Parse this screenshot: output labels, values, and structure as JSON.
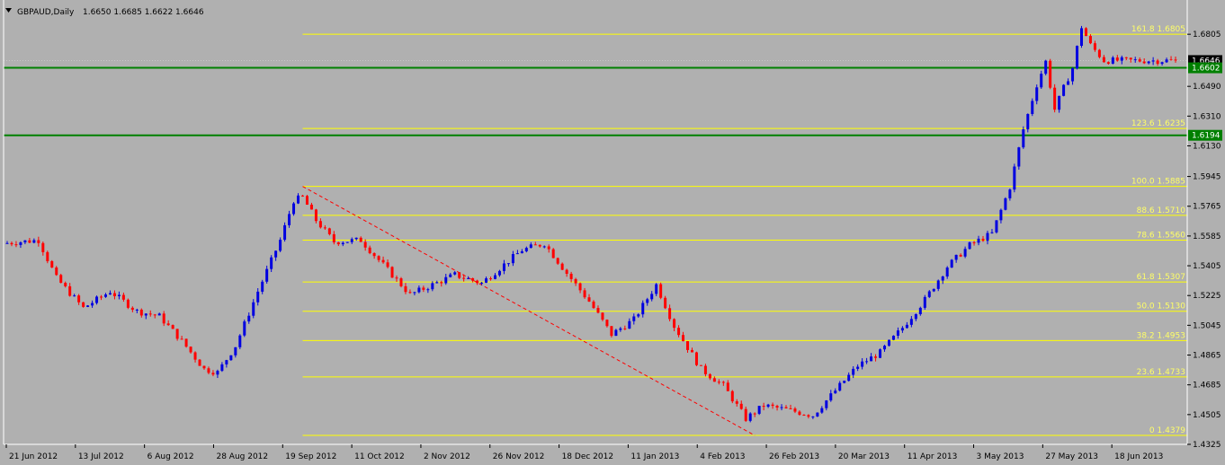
{
  "header": {
    "symbol": "GBPAUD,Daily",
    "ohlc": "1.6650 1.6685 1.6622 1.6646",
    "menu_icon": "triangle-down-icon"
  },
  "colors": {
    "background": "#b0b0b0",
    "axis": "#ffffff",
    "bull": "#0000e0",
    "bear": "#ff0000",
    "fib": "#ffff00",
    "fib_text": "#ffff66",
    "support": "#008000",
    "trend": "#ff0000",
    "text": "#000000"
  },
  "chart_data": {
    "type": "candlestick",
    "title": "GBPAUD,Daily",
    "y_range": [
      1.4325,
      1.6985
    ],
    "y_ticks": [
      "1.6805",
      "1.6490",
      "1.6310",
      "1.6130",
      "1.5945",
      "1.5765",
      "1.5585",
      "1.5405",
      "1.5225",
      "1.5045",
      "1.4865",
      "1.4685",
      "1.4505",
      "1.4325"
    ],
    "x_labels": [
      "21 Jun 2012",
      "13 Jul 2012",
      "6 Aug 2012",
      "28 Aug 2012",
      "19 Sep 2012",
      "11 Oct 2012",
      "2 Nov 2012",
      "26 Nov 2012",
      "18 Dec 2012",
      "11 Jan 2013",
      "4 Feb 2013",
      "26 Feb 2013",
      "20 Mar 2013",
      "11 Apr 2013",
      "3 May 2013",
      "27 May 2013",
      "18 Jun 2013"
    ],
    "bar_count": 262,
    "fib_levels": [
      {
        "label": "161.8 1.6805",
        "value": 1.6805
      },
      {
        "label": "123.6 1.6235",
        "value": 1.6235
      },
      {
        "label": "100.0 1.5885",
        "value": 1.5885
      },
      {
        "label": "88.6 1.5710",
        "value": 1.571
      },
      {
        "label": "78.6 1.5560",
        "value": 1.556
      },
      {
        "label": "61.8 1.5307",
        "value": 1.5307
      },
      {
        "label": "50.0 1.5130",
        "value": 1.513
      },
      {
        "label": "38.2 1.4953",
        "value": 1.4953
      },
      {
        "label": "23.6 1.4733",
        "value": 1.4733
      },
      {
        "label": "0 1.4379",
        "value": 1.4379
      }
    ],
    "support_lines": [
      {
        "label": "1.6602",
        "value": 1.6602
      },
      {
        "label": "1.6194",
        "value": 1.6194
      }
    ],
    "current_price": {
      "label": "1.6646",
      "value": 1.6646
    },
    "trendline": {
      "from": [
        66,
        1.5885
      ],
      "to": [
        167,
        1.4379
      ]
    },
    "anchors": [
      [
        0,
        1.554
      ],
      [
        8,
        1.556
      ],
      [
        12,
        1.533
      ],
      [
        18,
        1.515
      ],
      [
        24,
        1.525
      ],
      [
        30,
        1.513
      ],
      [
        35,
        1.51
      ],
      [
        40,
        1.495
      ],
      [
        45,
        1.478
      ],
      [
        48,
        1.476
      ],
      [
        52,
        1.492
      ],
      [
        57,
        1.525
      ],
      [
        62,
        1.556
      ],
      [
        65,
        1.58
      ],
      [
        67,
        1.582
      ],
      [
        70,
        1.568
      ],
      [
        74,
        1.555
      ],
      [
        80,
        1.556
      ],
      [
        86,
        1.538
      ],
      [
        91,
        1.523
      ],
      [
        96,
        1.529
      ],
      [
        101,
        1.535
      ],
      [
        107,
        1.53
      ],
      [
        111,
        1.539
      ],
      [
        116,
        1.55
      ],
      [
        121,
        1.554
      ],
      [
        126,
        1.536
      ],
      [
        131,
        1.519
      ],
      [
        136,
        1.499
      ],
      [
        141,
        1.508
      ],
      [
        146,
        1.529
      ],
      [
        150,
        1.504
      ],
      [
        156,
        1.478
      ],
      [
        161,
        1.468
      ],
      [
        166,
        1.448
      ],
      [
        170,
        1.456
      ],
      [
        176,
        1.453
      ],
      [
        181,
        1.45
      ],
      [
        186,
        1.465
      ],
      [
        191,
        1.48
      ],
      [
        196,
        1.488
      ],
      [
        201,
        1.503
      ],
      [
        206,
        1.52
      ],
      [
        211,
        1.54
      ],
      [
        216,
        1.553
      ],
      [
        221,
        1.56
      ],
      [
        225,
        1.588
      ],
      [
        228,
        1.623
      ],
      [
        231,
        1.65
      ],
      [
        233,
        1.664
      ],
      [
        235,
        1.635
      ],
      [
        237,
        1.648
      ],
      [
        239,
        1.66
      ],
      [
        241,
        1.685
      ],
      [
        243,
        1.674
      ],
      [
        246,
        1.6646
      ]
    ]
  }
}
